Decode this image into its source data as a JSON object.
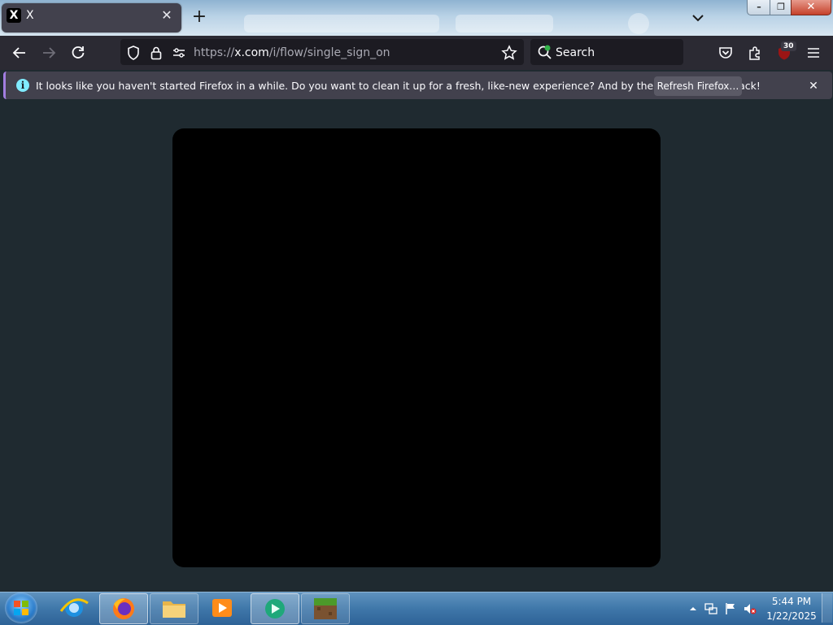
{
  "browser": {
    "tab": {
      "favicon": "X",
      "title": "X"
    },
    "new_tab": "+",
    "url": {
      "prefix": "https://",
      "domain": "x.com",
      "path": "/i/flow/single_sign_on"
    },
    "search_placeholder": "Search",
    "extension_badge": "30"
  },
  "notification": {
    "message": "It looks like you haven't started Firefox in a while. Do you want to clean it up for a fresh, like-new experience? And by the way, welcome back!",
    "button": "Refresh Firefox…",
    "close": "✕"
  },
  "window_controls": {
    "minimize": "–",
    "maximize": "❐",
    "close": "✕"
  },
  "taskbar": {
    "time": "5:44 PM",
    "date": "1/22/2025",
    "apps": [
      "internet-explorer",
      "firefox",
      "file-explorer",
      "media-player",
      "video-app",
      "minecraft"
    ]
  },
  "colors": {
    "page_bg": "#1f2a30",
    "modal_bg": "#000000",
    "toolbar_bg": "#2b2a33",
    "notification_bg": "#42414d",
    "info_icon": "#80ebff"
  }
}
